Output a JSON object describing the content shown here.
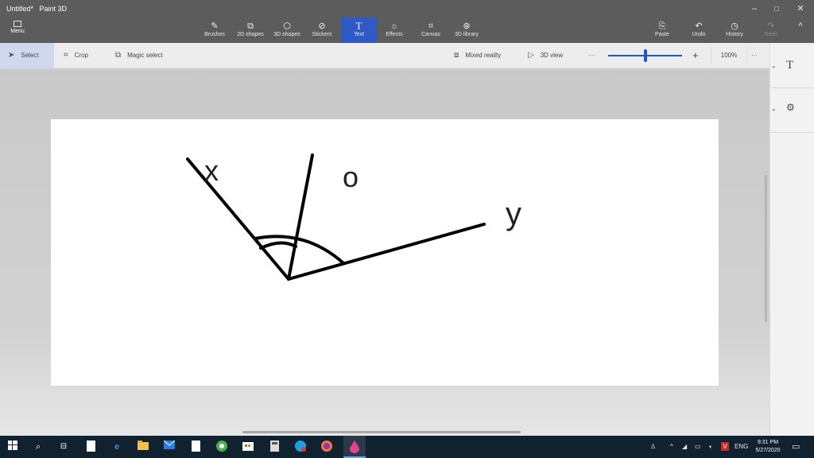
{
  "window": {
    "title_doc": "Untitled*",
    "title_app": "Paint 3D",
    "minimize": "–",
    "maximize": "□",
    "close": "✕"
  },
  "ribbon": {
    "menu_label": "Menu",
    "tools": [
      {
        "label": "Brushes",
        "icon": "brush-icon",
        "glyph": "✎"
      },
      {
        "label": "2D shapes",
        "icon": "2d-shapes-icon",
        "glyph": "⧉"
      },
      {
        "label": "3D shapes",
        "icon": "3d-shapes-icon",
        "glyph": "⬡"
      },
      {
        "label": "Stickers",
        "icon": "stickers-icon",
        "glyph": "⊘"
      },
      {
        "label": "Text",
        "icon": "text-icon",
        "glyph": "T"
      },
      {
        "label": "Effects",
        "icon": "effects-icon",
        "glyph": "☼"
      },
      {
        "label": "Canvas",
        "icon": "canvas-icon",
        "glyph": "⌗"
      },
      {
        "label": "3D library",
        "icon": "3d-library-icon",
        "glyph": "⊛"
      }
    ],
    "active_tool": "Text",
    "right_tools": [
      {
        "label": "Paste",
        "icon": "paste-icon",
        "glyph": "⎘"
      },
      {
        "label": "Undo",
        "icon": "undo-icon",
        "glyph": "↶"
      },
      {
        "label": "History",
        "icon": "history-icon",
        "glyph": "◷"
      },
      {
        "label": "Redo",
        "icon": "redo-icon",
        "glyph": "↷"
      }
    ],
    "collapse_glyph": "^"
  },
  "toolbar": {
    "select_label": "Select",
    "crop_label": "Crop",
    "magic_select_label": "Magic select",
    "mixed_reality_label": "Mixed reality",
    "view_3d_label": "3D view",
    "zoom_value": 0.5,
    "zoom_text": "100%",
    "more_glyph": "···",
    "zoom_minus": "—",
    "zoom_plus": "+"
  },
  "side_panel": {
    "text_glyph": "T",
    "settings_glyph": "⚙"
  },
  "canvas": {
    "labels": {
      "x": "x",
      "o": "o",
      "y": "y"
    }
  },
  "taskbar": {
    "time": "9:31 PM",
    "date": "5/27/2020",
    "language": "ENG"
  },
  "colors": {
    "accent": "#2f59c5",
    "ribbon_bg": "#5c5c5c",
    "taskbar_bg": "#10212f"
  }
}
